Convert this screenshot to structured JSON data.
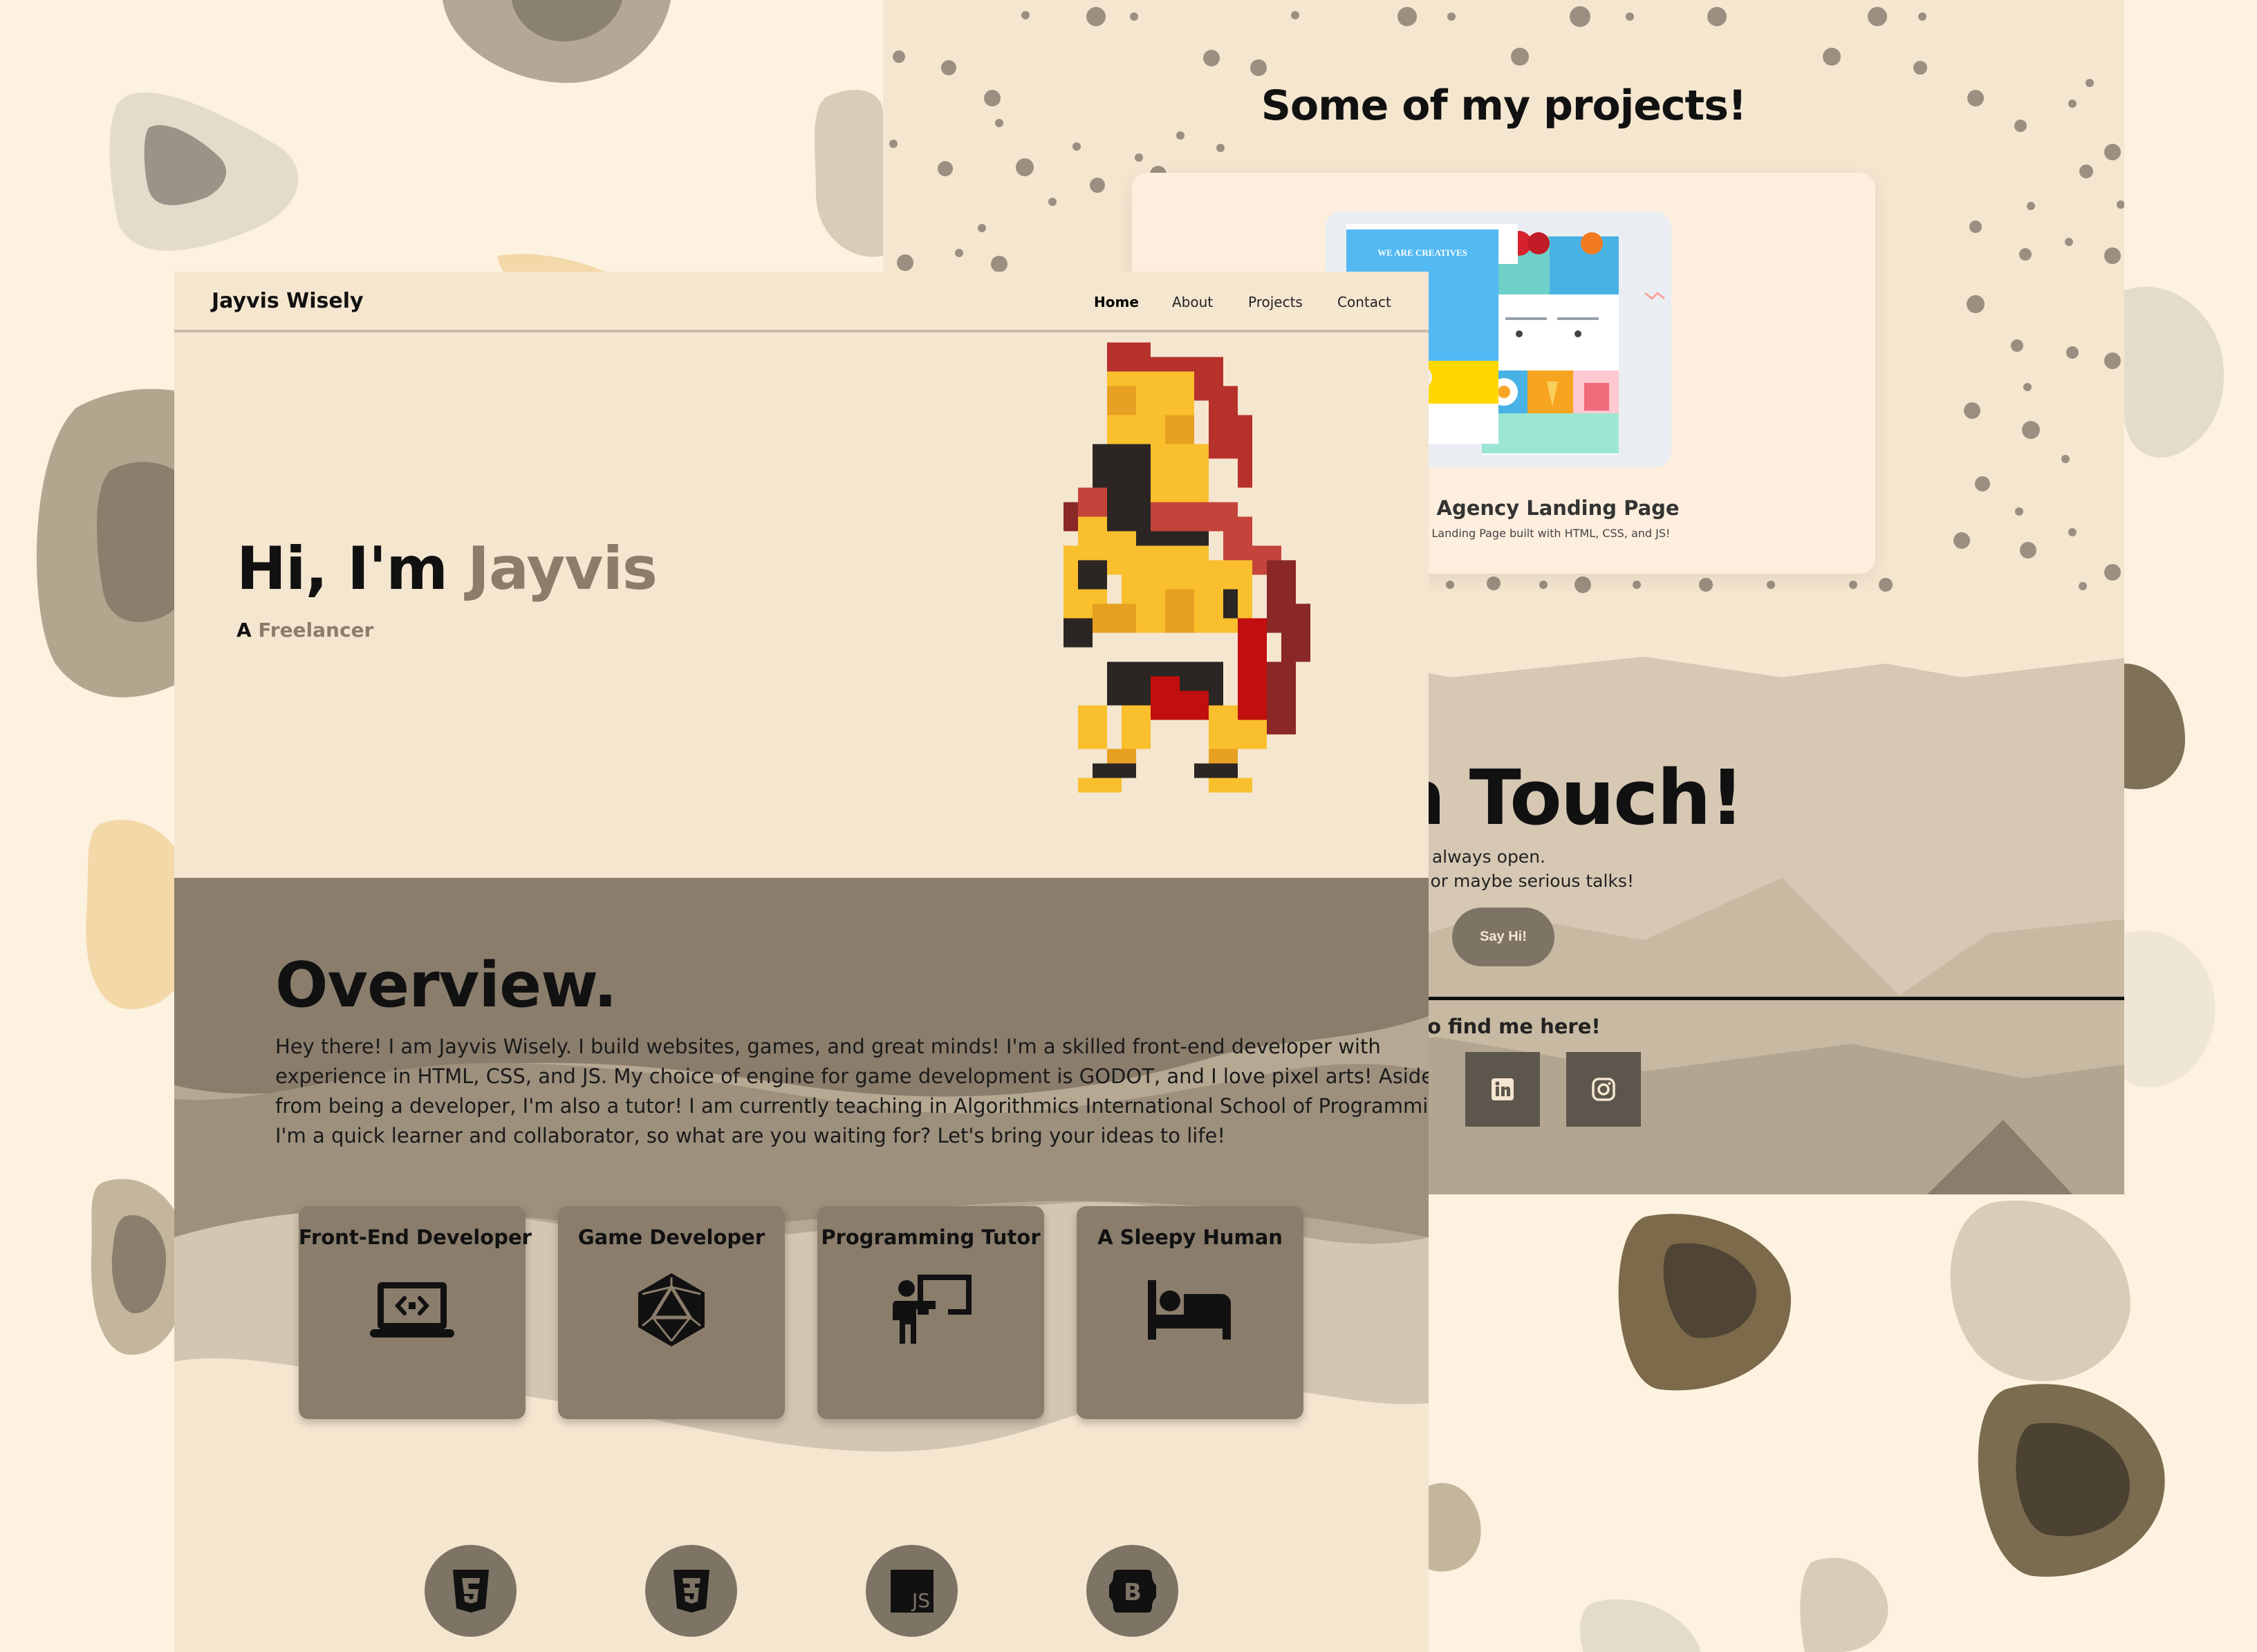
{
  "colors": {
    "background": "#fdf1df",
    "panel": "#f5e6d0",
    "accent": "#8b7d69",
    "card": "#8b7d6c",
    "dark_button": "#7d7465",
    "social_tile": "#5d564d"
  },
  "projects": {
    "heading": "Some of my projects!",
    "card": {
      "thumb_caption": "WE ARE CREATIVES",
      "title": "de Agency Landing Page",
      "description": "cy Landing Page built with HTML, CSS, and JS!"
    }
  },
  "contact": {
    "title": "et in Touch!",
    "line1": "inbox is always open.",
    "line2": "it-chats or maybe serious talks!",
    "say_hi": "Say Hi!",
    "find_me": "an also find me here!",
    "socials": [
      "linkedin-icon",
      "instagram-icon"
    ]
  },
  "nav": {
    "brand": "Jayvis Wisely",
    "links": [
      "Home",
      "About",
      "Projects",
      "Contact"
    ],
    "active": "Home"
  },
  "hero": {
    "greeting": "Hi, I'm ",
    "name": "Jayvis",
    "sub_prefix": "A ",
    "role": "Freelancer"
  },
  "overview": {
    "title": "Overview.",
    "lines": [
      "Hey there! I am Jayvis Wisely. I build websites, games, and great minds! I'm a skilled front-end developer with",
      "experience in HTML, CSS, and JS. My choice of engine for game development is GODOT, and I love pixel arts! Aside",
      "from being a developer, I'm also a tutor! I am currently teaching in Algorithmics International School of Programming.",
      "I'm a quick learner and collaborator, so what are you waiting for? Let's bring your ideas to life!"
    ]
  },
  "services": [
    {
      "label": "Front-End Developer",
      "icon": "laptop-code-icon"
    },
    {
      "label": "Game Developer",
      "icon": "d20-dice-icon"
    },
    {
      "label": "Programming Tutor",
      "icon": "teacher-board-icon"
    },
    {
      "label": "A Sleepy Human",
      "icon": "bed-icon"
    }
  ],
  "tech_stack": [
    {
      "icon": "html5-icon",
      "glyph": "5"
    },
    {
      "icon": "css3-icon",
      "glyph": "3"
    },
    {
      "icon": "javascript-icon",
      "glyph": "JS"
    },
    {
      "icon": "bootstrap-icon",
      "glyph": "B"
    }
  ]
}
